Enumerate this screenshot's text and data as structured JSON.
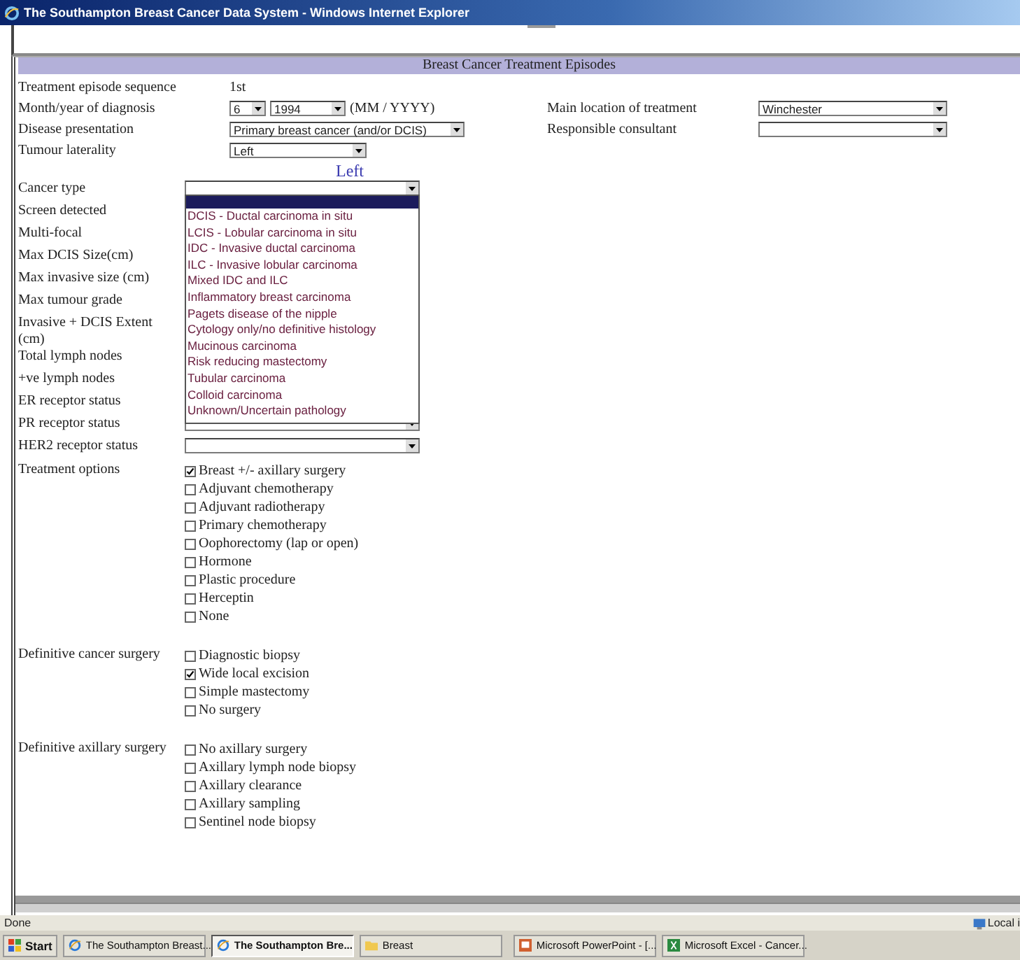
{
  "window": {
    "title": "The Southampton Breast Cancer Data System - Windows Internet Explorer"
  },
  "header": "Breast Cancer Treatment Episodes",
  "top_rows": [
    {
      "label": "Treatment episode sequence",
      "kind": "text",
      "value": "1st"
    },
    {
      "label": "Month/year of diagnosis",
      "kind": "month_year",
      "month": "6",
      "year": "1994",
      "hint": "(MM / YYYY)"
    },
    {
      "label": "Disease presentation",
      "kind": "select",
      "value": "Primary breast cancer (and/or DCIS)"
    },
    {
      "label": "Tumour laterality",
      "kind": "select",
      "value": "Left"
    }
  ],
  "right_rows": [
    {
      "label": "Main location of treatment",
      "value": "Winchester"
    },
    {
      "label": "Responsible consultant"
    }
  ],
  "side_heading": "Left",
  "tumour_rows": [
    {
      "label": "Cancer type",
      "kind": "select",
      "expanded": true
    },
    {
      "label": "Screen detected",
      "kind": "covered"
    },
    {
      "label": "Multi-focal",
      "kind": "covered"
    },
    {
      "label": "Max DCIS Size(cm)",
      "kind": "covered"
    },
    {
      "label": "Max invasive size (cm)",
      "kind": "covered"
    },
    {
      "label": "Max tumour grade",
      "kind": "covered"
    },
    {
      "label": "Invasive + DCIS Extent (cm)",
      "kind": "covered"
    },
    {
      "label": "Total lymph nodes",
      "kind": "covered"
    },
    {
      "label": "+ve lymph nodes",
      "kind": "covered"
    },
    {
      "label": "ER receptor status",
      "kind": "covered"
    },
    {
      "label": "PR receptor status",
      "kind": "select",
      "expanded": false
    },
    {
      "label": "HER2 receptor status",
      "kind": "select",
      "expanded": false
    }
  ],
  "dropdown_options": [
    "DCIS - Ductal carcinoma in situ",
    "LCIS - Lobular carcinoma in situ",
    "IDC - Invasive ductal carcinoma",
    "ILC - Invasive lobular carcinoma",
    "Mixed IDC and ILC",
    "Inflammatory breast carcinoma",
    "Pagets disease of the nipple",
    "Cytology only/no definitive histology",
    "Mucinous carcinoma",
    "Risk reducing mastectomy",
    "Tubular carcinoma",
    "Colloid carcinoma",
    "Unknown/Uncertain pathology"
  ],
  "groups": [
    {
      "label": "Treatment options",
      "options": [
        {
          "label": "Breast +/- axillary surgery",
          "checked": true
        },
        {
          "label": "Adjuvant chemotherapy",
          "checked": false
        },
        {
          "label": "Adjuvant radiotherapy",
          "checked": false
        },
        {
          "label": "Primary chemotherapy",
          "checked": false
        },
        {
          "label": "Oophorectomy (lap or open)",
          "checked": false
        },
        {
          "label": "Hormone",
          "checked": false
        },
        {
          "label": "Plastic procedure",
          "checked": false
        },
        {
          "label": "Herceptin",
          "checked": false
        },
        {
          "label": "None",
          "checked": false
        }
      ]
    },
    {
      "label": "Definitive cancer surgery",
      "options": [
        {
          "label": "Diagnostic biopsy",
          "checked": false
        },
        {
          "label": "Wide local excision",
          "checked": true
        },
        {
          "label": "Simple mastectomy",
          "checked": false
        },
        {
          "label": "No surgery",
          "checked": false
        }
      ]
    },
    {
      "label": "Definitive axillary surgery",
      "options": [
        {
          "label": "No axillary surgery",
          "checked": false
        },
        {
          "label": "Axillary lymph node biopsy",
          "checked": false
        },
        {
          "label": "Axillary clearance",
          "checked": false
        },
        {
          "label": "Axillary sampling",
          "checked": false
        },
        {
          "label": "Sentinel node biopsy",
          "checked": false
        }
      ]
    }
  ],
  "status_bar": {
    "text": "Done",
    "zone": "Local i"
  },
  "taskbar": {
    "start": "Start",
    "items": [
      {
        "label": "The Southampton Breast...",
        "kind": "browser",
        "selected": false
      },
      {
        "label": "The Southampton Bre...",
        "kind": "browser",
        "selected": true
      },
      {
        "label": "Breast",
        "kind": "folder",
        "selected": false
      },
      {
        "label": "Microsoft PowerPoint - [...",
        "kind": "slides",
        "selected": false
      },
      {
        "label": "Microsoft Excel - Cancer...",
        "kind": "sheet",
        "selected": false
      }
    ]
  }
}
